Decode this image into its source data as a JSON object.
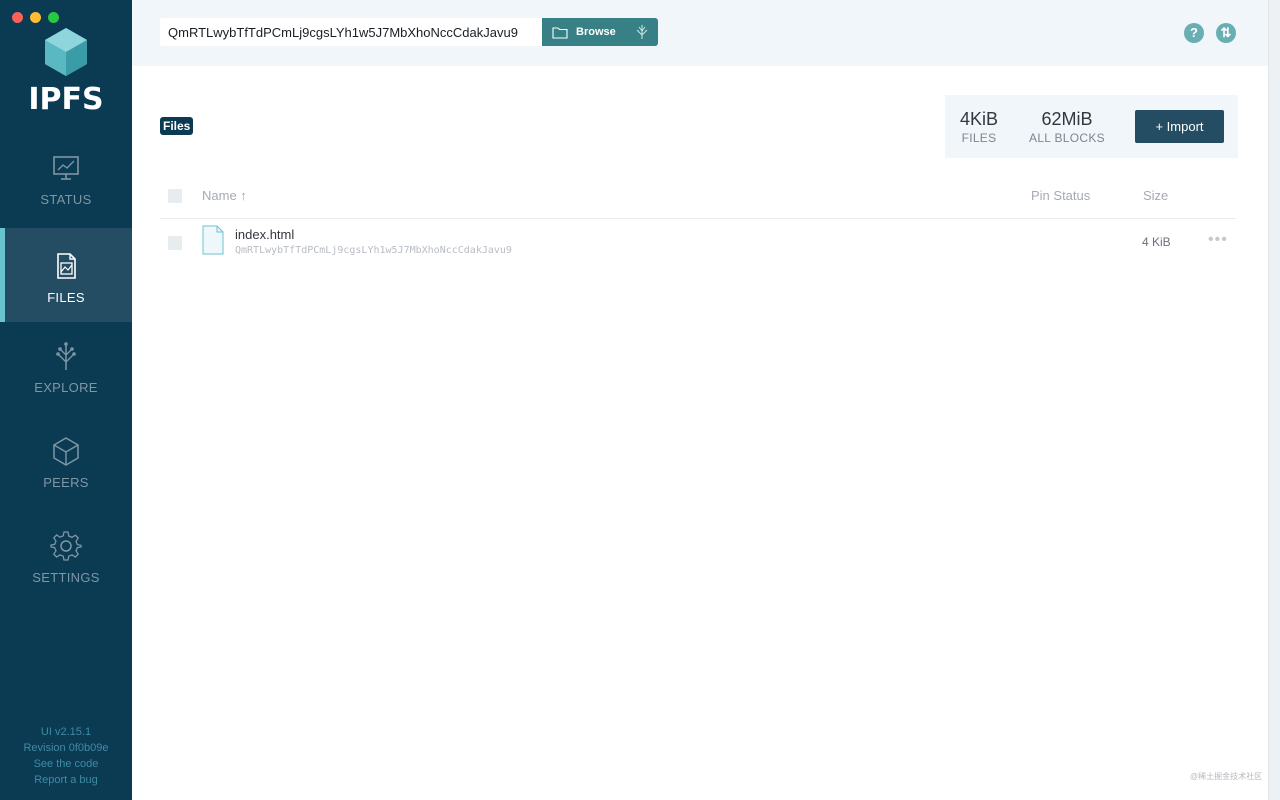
{
  "window": {
    "traffic_lights": [
      "close",
      "minimize",
      "zoom"
    ]
  },
  "sidebar": {
    "logo_text": "IPFS",
    "items": [
      {
        "label": "STATUS",
        "icon": "status-monitor-icon",
        "active": false
      },
      {
        "label": "FILES",
        "icon": "files-icon",
        "active": true
      },
      {
        "label": "EXPLORE",
        "icon": "explore-tree-icon",
        "active": false
      },
      {
        "label": "PEERS",
        "icon": "peers-cube-icon",
        "active": false
      },
      {
        "label": "SETTINGS",
        "icon": "gear-icon",
        "active": false
      }
    ],
    "footer": {
      "version": "UI v2.15.1",
      "revision": "Revision 0f0b09e",
      "code_link": "See the code",
      "bug_link": "Report a bug"
    }
  },
  "topbar": {
    "hash_value": "QmRTLwybTfTdPCmLj9cgsLYh1w5J7MbXhoNccCdakJavu9",
    "browse_label": "Browse",
    "help_icon": "help-icon",
    "sync_icon": "sync-arrows-icon"
  },
  "files": {
    "breadcrumb": "Files",
    "stats": {
      "files_value": "4KiB",
      "files_label": "FILES",
      "blocks_value": "62MiB",
      "blocks_label": "ALL BLOCKS"
    },
    "import_label": "+ Import",
    "columns": {
      "name": "Name ↑",
      "pin_status": "Pin Status",
      "size": "Size"
    },
    "rows": [
      {
        "name": "index.html",
        "cid": "QmRTLwybTfTdPCmLj9cgsLYh1w5J7MbXhoNccCdakJavu9",
        "pin_status": "",
        "size": "4 KiB",
        "more": "•••"
      }
    ]
  },
  "watermark": "@稀土掘金技术社区",
  "colors": {
    "sidebar_bg": "#0b3a53",
    "sidebar_active_bg": "#244c63",
    "accent_teal": "#378085",
    "active_bar": "#69c4cd",
    "topbar_bg": "#f0f6fa"
  }
}
